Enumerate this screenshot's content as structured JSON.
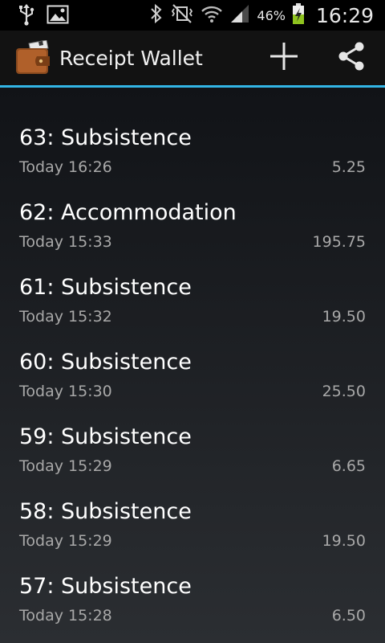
{
  "status_bar": {
    "battery_percent": "46%",
    "time": "16:29",
    "icons": [
      "usb-icon",
      "image-icon",
      "bluetooth-icon",
      "vibrate-mute-icon",
      "wifi-icon",
      "signal-icon",
      "battery-charging-icon"
    ]
  },
  "action_bar": {
    "title": "Receipt Wallet",
    "app_icon": "wallet-icon",
    "add_icon": "plus-icon",
    "share_icon": "share-icon",
    "accent_color": "#33b5e5"
  },
  "receipts": [
    {
      "title": "63: Subsistence",
      "time": "Today 16:26",
      "amount": "5.25"
    },
    {
      "title": "62: Accommodation",
      "time": "Today 15:33",
      "amount": "195.75"
    },
    {
      "title": "61: Subsistence",
      "time": "Today 15:32",
      "amount": "19.50"
    },
    {
      "title": "60: Subsistence",
      "time": "Today 15:30",
      "amount": "25.50"
    },
    {
      "title": "59: Subsistence",
      "time": "Today 15:29",
      "amount": "6.65"
    },
    {
      "title": "58: Subsistence",
      "time": "Today 15:29",
      "amount": "19.50"
    },
    {
      "title": "57: Subsistence",
      "time": "Today 15:28",
      "amount": "6.50"
    }
  ]
}
